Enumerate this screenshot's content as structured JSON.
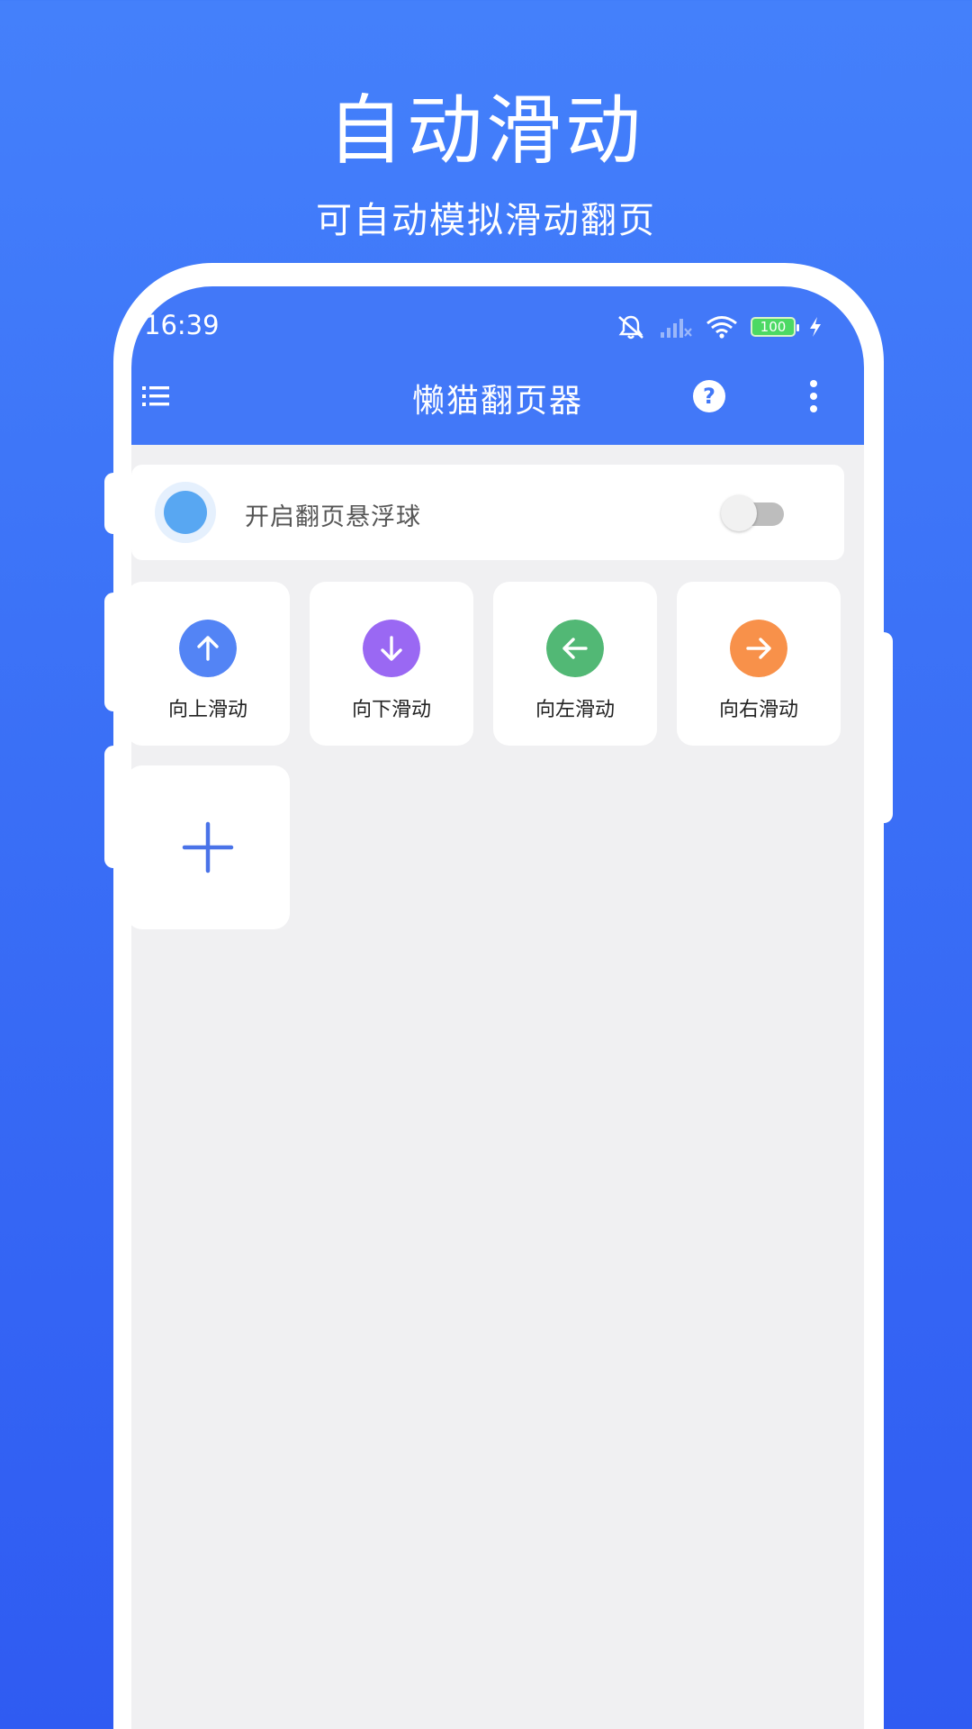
{
  "promo": {
    "title": "自动滑动",
    "subtitle": "可自动模拟滑动翻页"
  },
  "status_bar": {
    "time": "16:39",
    "battery": "100",
    "icons": [
      "mute-icon",
      "signal-icon",
      "wifi-icon",
      "battery-icon",
      "charging-icon"
    ]
  },
  "toolbar": {
    "title": "懒猫翻页器",
    "help_glyph": "?",
    "icons": [
      "menu-icon",
      "help-icon",
      "more-vertical-icon"
    ]
  },
  "float_ball": {
    "label": "开启翻页悬浮球",
    "enabled": false
  },
  "actions": [
    {
      "label": "向上滑动",
      "icon": "arrow-up-icon",
      "color": "#5384f5"
    },
    {
      "label": "向下滑动",
      "icon": "arrow-down-icon",
      "color": "#9a68f3"
    },
    {
      "label": "向左滑动",
      "icon": "arrow-left-icon",
      "color": "#52b875"
    },
    {
      "label": "向右滑动",
      "icon": "arrow-right-icon",
      "color": "#f8914a"
    }
  ],
  "add_card": {
    "icon": "plus-icon",
    "color": "#4a73e8"
  },
  "colors": {
    "background": "#3a6ff6",
    "header": "#4278f8",
    "screen_bg": "#f0f0f2"
  }
}
